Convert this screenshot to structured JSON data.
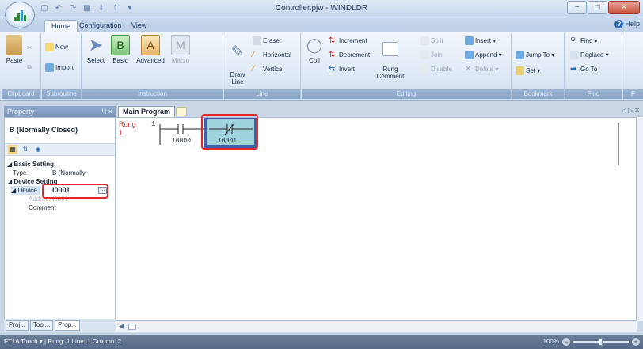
{
  "window": {
    "title": "Controller.pjw - WINDLDR",
    "minimize": "−",
    "maximize": "□",
    "close": "✕"
  },
  "tabs": [
    {
      "label": "Home",
      "active": true
    },
    {
      "label": "Configuration",
      "active": false
    },
    {
      "label": "View",
      "active": false
    }
  ],
  "help_label": "Help",
  "ribbon": {
    "clipboard": {
      "label": "Clipboard",
      "paste": "Paste"
    },
    "subroutine": {
      "label": "Subroutine",
      "new": "New",
      "import": "Import"
    },
    "instruction": {
      "label": "Instruction",
      "select": "Select",
      "basic": "Basic",
      "advanced": "Advanced",
      "macro": "Macro"
    },
    "line": {
      "label": "Line",
      "draw_line": "Draw\nLine",
      "eraser": "Eraser",
      "horizontal": "Horizontal",
      "vertical": "Vertical"
    },
    "editing": {
      "label": "Editing",
      "coil": "Coil",
      "increment": "Increment",
      "decrement": "Decrement",
      "invert": "Invert",
      "rung_comment": "Rung\nComment",
      "split": "Split",
      "join": "Join",
      "disable": "Disable",
      "insert": "Insert ▾",
      "append": "Append ▾",
      "delete": "Delete ▾"
    },
    "bookmark": {
      "label": "Bookmark",
      "jump_to": "Jump To ▾",
      "set": "Set ▾"
    },
    "find": {
      "label": "Find",
      "find": "Find ▾",
      "replace": "Replace ▾",
      "go_to": "Go To"
    },
    "overflow_label": "F"
  },
  "property_pane": {
    "header": "Property",
    "pin": "Ч ×",
    "title": "B (Normally Closed)",
    "rows": [
      {
        "kind": "cat",
        "key": "◢ Basic Setting",
        "value": ""
      },
      {
        "kind": "item",
        "key": "Type",
        "value": "B (Normally"
      },
      {
        "kind": "cat",
        "key": "◢ Device Setting",
        "value": ""
      },
      {
        "kind": "sel",
        "key": "◢ Device",
        "value": "I0001"
      },
      {
        "kind": "muted",
        "key": "Address",
        "value": "I0001"
      },
      {
        "kind": "item",
        "key": "Comment",
        "value": ""
      }
    ],
    "bottom_tabs": [
      "Proj...",
      "Tool...",
      "Prop..."
    ]
  },
  "editor": {
    "tab_label": "Main Program",
    "rung_label": "Rung\n1",
    "rung_number": "1",
    "contacts": [
      {
        "device": "I0000",
        "type": "NO"
      },
      {
        "device": "I0001",
        "type": "NC",
        "selected": true
      }
    ]
  },
  "statusbar": {
    "text": "FT1A Touch ▾ | Rung: 1  Line: 1  Column: 2",
    "zoom": "100%",
    "zoom_level_percent": 100
  },
  "colors": {
    "accent": "#2d68b5",
    "highlight": "#e0282a",
    "selected_cell_fill": "#9fd4dc",
    "selected_cell_border": "#3f5fa8"
  }
}
